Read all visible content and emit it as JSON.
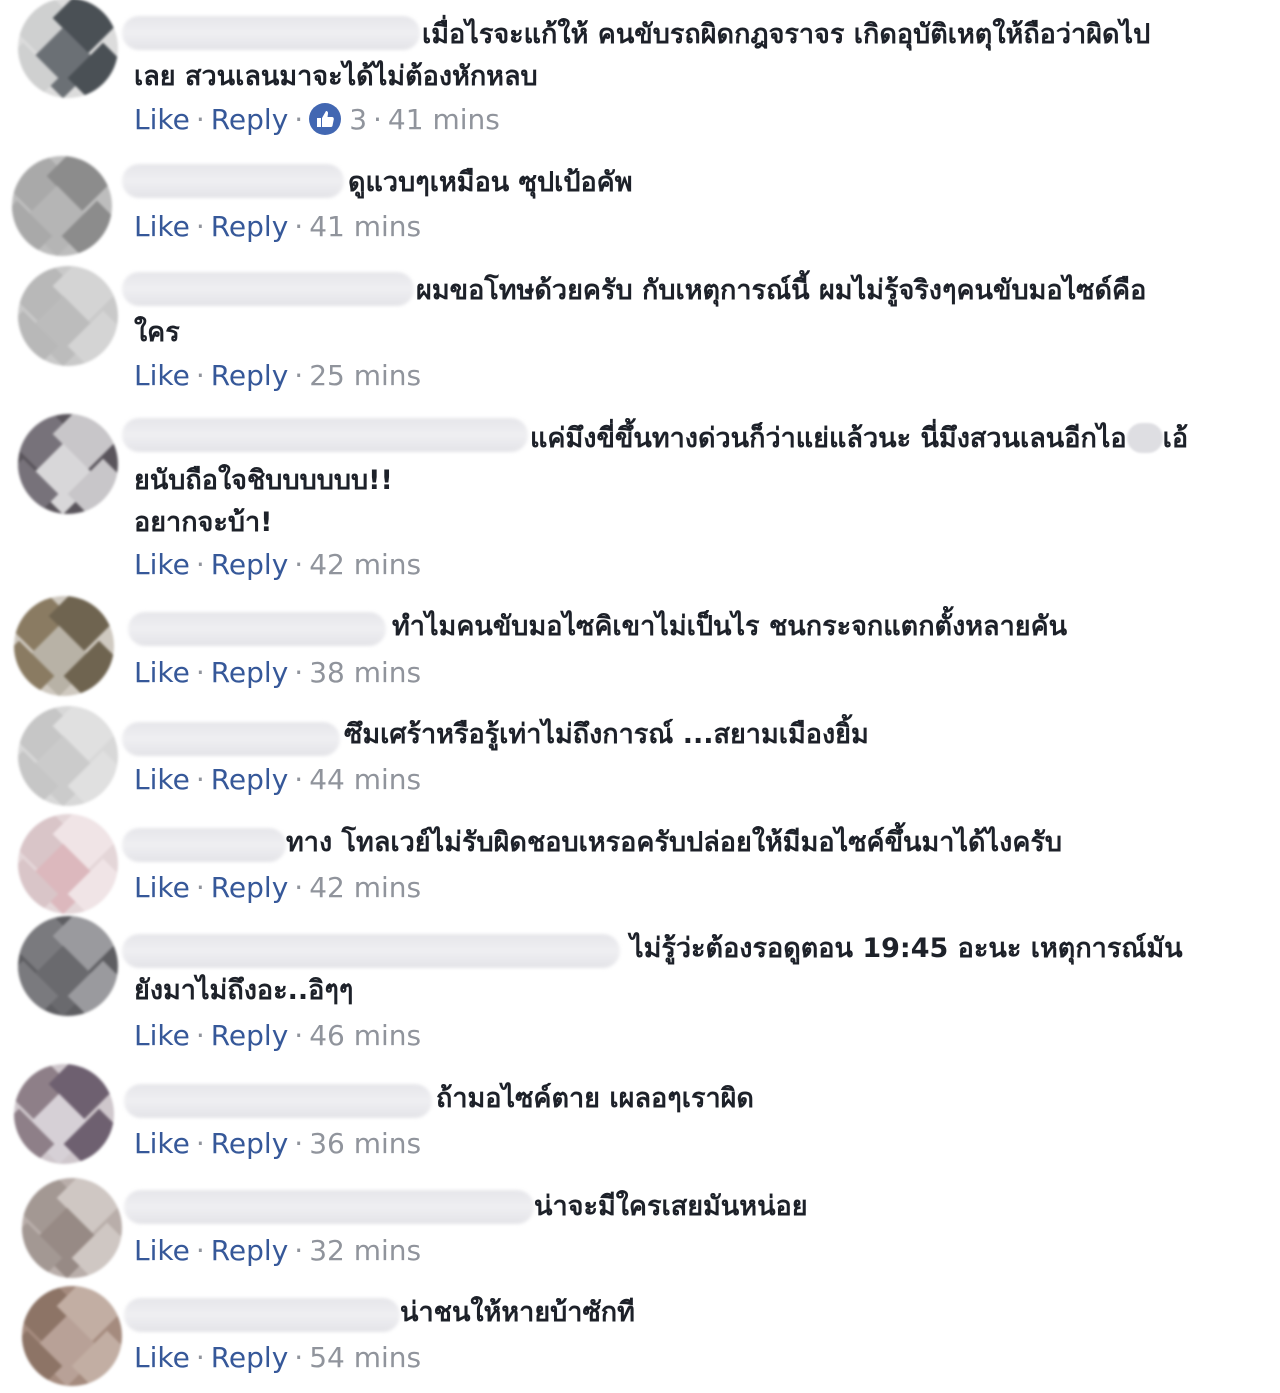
{
  "ui": {
    "like_label": "Like",
    "reply_label": "Reply",
    "separator": "·",
    "link_color": "#365899",
    "meta_color": "#90949c",
    "text_color": "#1d2129",
    "like_badge_color": "#4267b2"
  },
  "comments": [
    {
      "text": "เมื่อไรจะแก้ให้ คนขับรถผิดกฎจราจร เกิดอุบัติเหตุให้ถือว่าผิดไป\nเลย สวนเลนมาจะได้ไม่ต้องหักหลบ",
      "reaction_count": "3",
      "time": "41 mins",
      "avatar_colors": [
        "#dcdcdc",
        "#cfd0d0",
        "#4a5055",
        "#6b7075"
      ]
    },
    {
      "text": "ดูแวบๆเหมือน ซุปเป้อคัพ",
      "time": "41 mins",
      "avatar_colors": [
        "#bdbdbd",
        "#a9a9a9",
        "#8c8c8c",
        "#b5b5b5"
      ]
    },
    {
      "text": "ผมขอโทษด้วยครับ กับเหตุการณ์นี้ ผมไม่รู้จริงๆคนขับมอไซด์คือ\nใคร",
      "time": "25 mins",
      "avatar_colors": [
        "#c9c9c9",
        "#b8b8b8",
        "#d4d4d4",
        "#bcbcbc"
      ]
    },
    {
      "text": "แค่มึงขี่ขึ้นทางด่วนก็ว่าแย่แล้วนะ นี่มึงสวนเลนอีกไอ",
      "text_tail": "เอ้\nยนับถือใจชิบบบบบบ!!\nอยากจะบ้า!",
      "time": "42 mins",
      "avatar_colors": [
        "#5a555c",
        "#77727a",
        "#c8c6c9",
        "#d8d7d9"
      ]
    },
    {
      "text": "ทำไมคนขับมอไซคิเขาไม่เป็นไร ชนกระจกแตกตั้งหลายคัน",
      "time": "38 mins",
      "avatar_colors": [
        "#cfc9c0",
        "#8a7b62",
        "#6f6450",
        "#b8b2a6"
      ]
    },
    {
      "text": "ซึมเศร้าหรือรู้เท่าไม่ถึงการณ์ ...สยามเมืองยิ้ม",
      "time": "44 mins",
      "avatar_colors": [
        "#d8d8d8",
        "#c6c6c6",
        "#e0e0e0",
        "#cbcbcb"
      ]
    },
    {
      "text": "ทาง โทลเวย์ไม่รับผิดชอบเหรอครับปล่อยให้มีมอไซค์ขึ้นมาได้ไงครับ",
      "time": "42 mins",
      "avatar_colors": [
        "#e4d6d8",
        "#d9c5c8",
        "#f0e4e6",
        "#dcb8bd"
      ]
    },
    {
      "text": "ไม่รู้ว่ะต้องรอดูตอน 19:45 อะนะ เหตุการณ์มัน\nยังมาไม่ถึงอะ..อิๆๆ",
      "time": "46 mins",
      "avatar_colors": [
        "#5e5e62",
        "#7a7a7e",
        "#9a9a9e",
        "#6a6a6e"
      ]
    },
    {
      "text": "ถ้ามอไซค์ตาย เผลอๆเราผิด",
      "time": "36 mins",
      "avatar_colors": [
        "#cfc7cc",
        "#8e7f88",
        "#6e6070",
        "#d6d0d6"
      ]
    },
    {
      "text": "น่าจะมีใครเสยมันหน่อย",
      "time": "32 mins",
      "avatar_colors": [
        "#b9aeaa",
        "#a39893",
        "#cfc7c3",
        "#978a85"
      ]
    },
    {
      "text": "น่าชนให้หายบ้าซักที",
      "time": "54 mins",
      "avatar_colors": [
        "#a58b7e",
        "#8d7466",
        "#c2aea3",
        "#b8a197"
      ]
    }
  ]
}
